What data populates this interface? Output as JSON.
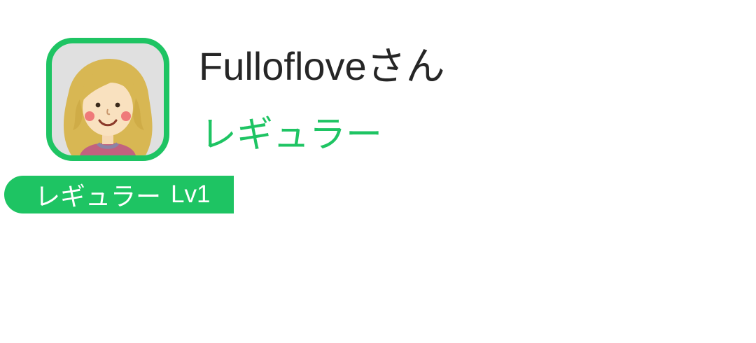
{
  "profile": {
    "user_name": "Fullofloveさん",
    "rank": "レギュラー",
    "badge": {
      "rank": "レギュラー",
      "level": "Lv1"
    },
    "avatar_icon": "girl-avatar-icon"
  },
  "colors": {
    "accent": "#1ec463",
    "text": "#262626",
    "avatar_bg": "#e0e0e0"
  }
}
